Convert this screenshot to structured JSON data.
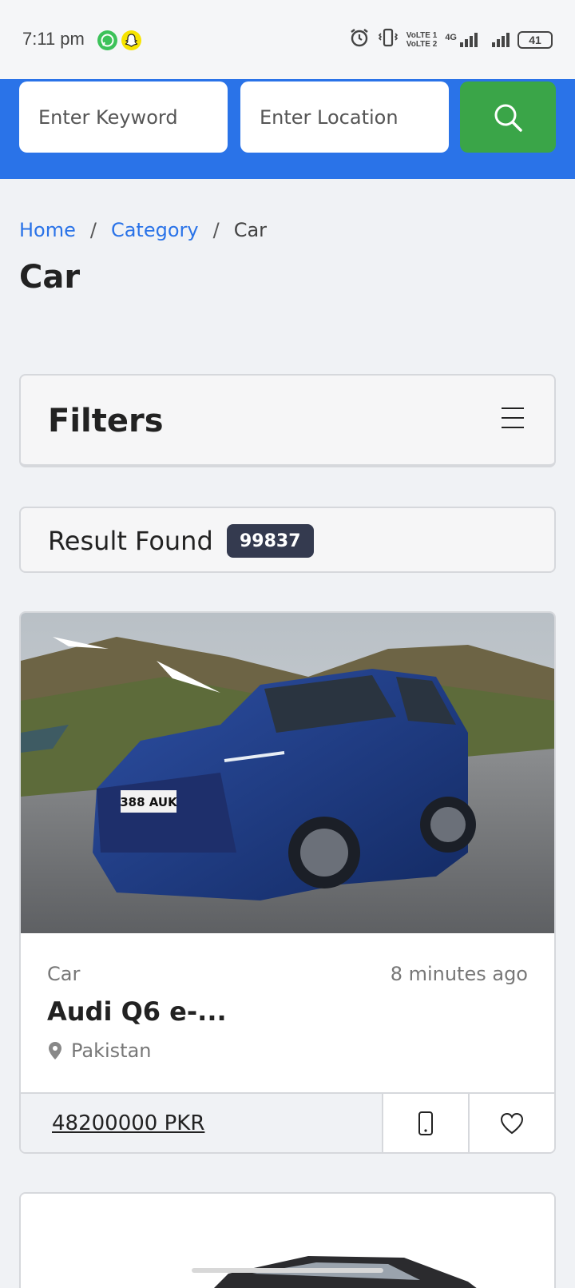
{
  "status_bar": {
    "time": "7:11 pm",
    "network": "4G",
    "volte_1": "VoLTE 1",
    "volte_2": "VoLTE 2",
    "battery": "41",
    "icons": [
      "whatsapp-icon",
      "snapchat-icon",
      "alarm-icon",
      "vibrate-icon",
      "signal-icon",
      "battery-icon"
    ]
  },
  "search": {
    "keyword_placeholder": "Enter Keyword",
    "location_placeholder": "Enter Location",
    "button_icon": "search-icon"
  },
  "breadcrumb": {
    "items": [
      "Home",
      "Category",
      "Car"
    ],
    "separator": "/"
  },
  "page": {
    "title": "Car"
  },
  "filters": {
    "title": "Filters",
    "menu_icon": "hamburger-menu-icon"
  },
  "results": {
    "label": "Result Found",
    "count": "99837"
  },
  "listings": [
    {
      "category": "Car",
      "posted": "8 minutes ago",
      "title": "Audi Q6 e-...",
      "location": "Pakistan",
      "price": "48200000 PKR",
      "plate": "388 AUK",
      "image_desc": "blue-suv-photo"
    }
  ],
  "colors": {
    "header_blue": "#2a73e8",
    "search_green": "#3aa548",
    "link_blue": "#2a73e8",
    "badge_dark": "#343a4f",
    "page_bg": "#f0f2f5"
  }
}
